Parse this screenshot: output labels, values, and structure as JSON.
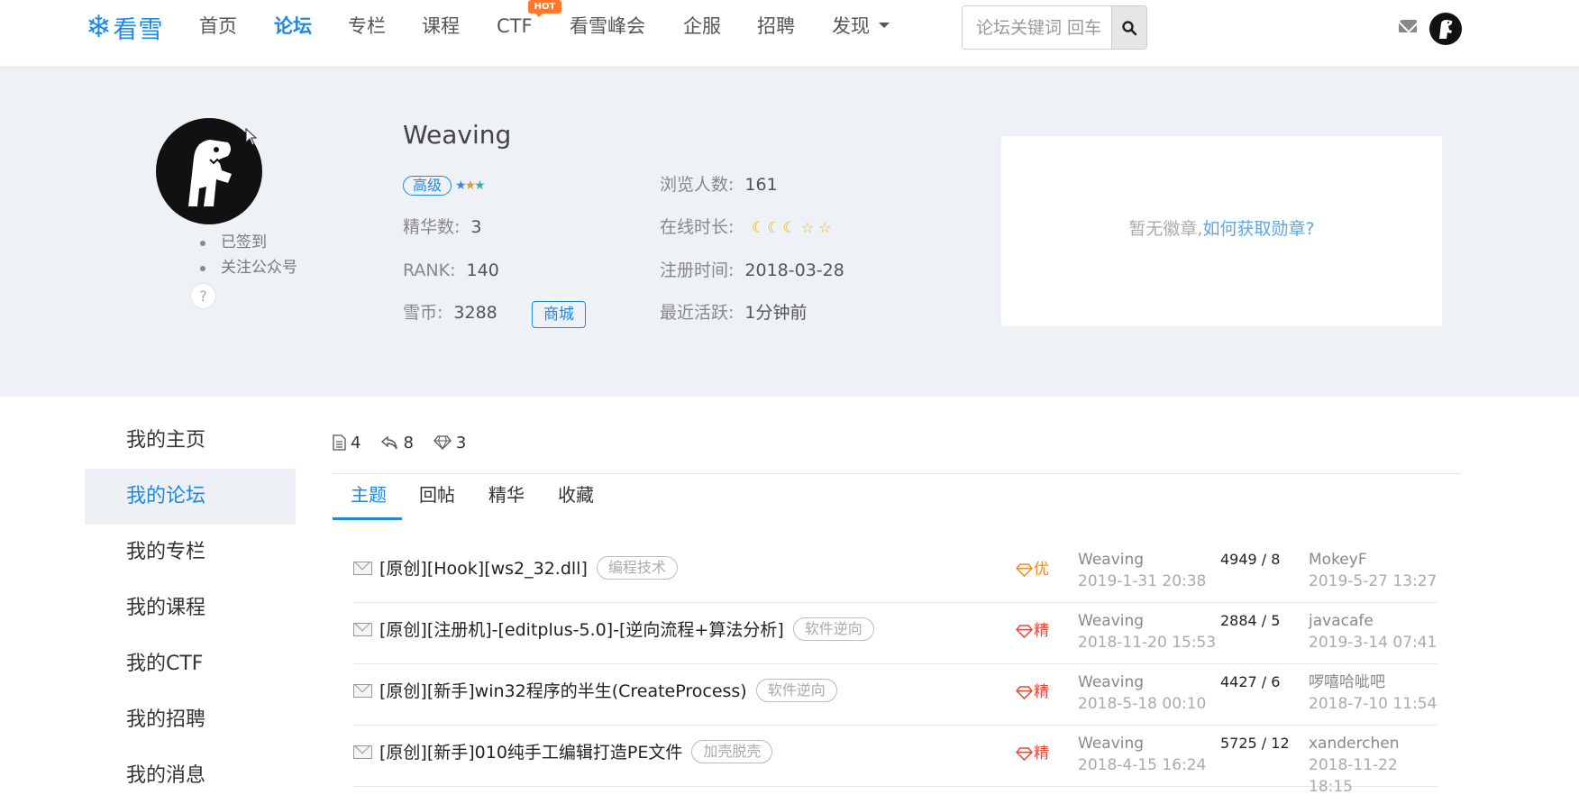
{
  "nav": {
    "logo_text": "看雪",
    "items": [
      "首页",
      "论坛",
      "专栏",
      "课程",
      "CTF",
      "看雪峰会",
      "企服",
      "招聘",
      "发现"
    ],
    "active": "论坛",
    "hot_badge": "HOT",
    "search_placeholder": "论坛关键词 回车",
    "icons": [
      "search-icon",
      "mail-icon",
      "avatar"
    ]
  },
  "profile": {
    "username": "Weaving",
    "level": "高级",
    "side_links": [
      "已签到",
      "关注公众号"
    ],
    "help": "?",
    "stats": {
      "jinghua_label": "精华数:",
      "jinghua_value": "3",
      "rank_label": "RANK:",
      "rank_value": "140",
      "xuebi_label": "雪币:",
      "xuebi_value": "3288",
      "mall_label": "商城",
      "views_label": "浏览人数:",
      "views_value": "161",
      "online_label": "在线时长:",
      "register_label": "注册时间:",
      "register_value": "2018-03-28",
      "active_label": "最近活跃:",
      "active_value": "1分钟前"
    },
    "online_icons": [
      "moon-icon",
      "moon-icon",
      "moon-icon",
      "star-icon",
      "star-icon"
    ],
    "badge_empty_text": "暂无徽章,",
    "badge_link_text": "如何获取勋章?"
  },
  "left_menu": {
    "items": [
      "我的主页",
      "我的论坛",
      "我的专栏",
      "我的课程",
      "我的CTF",
      "我的招聘",
      "我的消息"
    ],
    "active": "我的论坛"
  },
  "counts": {
    "topics": "4",
    "replies": "8",
    "jinghua": "3"
  },
  "tabs": {
    "items": [
      "主题",
      "回帖",
      "精华",
      "收藏"
    ],
    "active": "主题"
  },
  "threads": [
    {
      "title": "[原创][Hook][ws2_32.dll]",
      "tag": "编程技术",
      "flag": "优",
      "author": "Weaving",
      "post_time": "2019-1-31 20:38",
      "stats": "4949 / 8",
      "last_user": "MokeyF",
      "last_time": "2019-5-27 13:27"
    },
    {
      "title": "[原创][注册机]-[editplus-5.0]-[逆向流程+算法分析]",
      "tag": "软件逆向",
      "flag": "精",
      "author": "Weaving",
      "post_time": "2018-11-20 15:53",
      "stats": "2884 / 5",
      "last_user": "javacafe",
      "last_time": "2019-3-14 07:41"
    },
    {
      "title": "[原创][新手]win32程序的半生(CreateProcess)",
      "tag": "软件逆向",
      "flag": "精",
      "author": "Weaving",
      "post_time": "2018-5-18 00:10",
      "stats": "4427 / 6",
      "last_user": "啰嘻哈呲吧",
      "last_time": "2018-7-10 11:54"
    },
    {
      "title": "[原创][新手]010纯手工编辑打造PE文件",
      "tag": "加壳脱壳",
      "flag": "精",
      "author": "Weaving",
      "post_time": "2018-4-15 16:24",
      "stats": "5725 / 12",
      "last_user": "xanderchen",
      "last_time": "2018-11-22 18:15"
    }
  ],
  "colors": {
    "accent": "#1e88e5",
    "hot": "#ff7a2e",
    "flag_you": "#f08a1f",
    "flag_jing": "#e14b3b",
    "profile_bg": "#eef1f5"
  }
}
